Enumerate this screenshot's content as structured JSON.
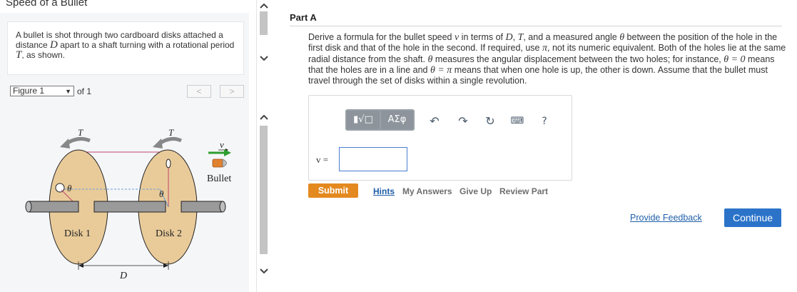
{
  "problem": {
    "title": "Speed of a Bullet",
    "intro_part1": "A bullet is shot through two cardboard disks attached a distance ",
    "intro_var1": "D",
    "intro_part2": " apart to a shaft turning with a rotational period ",
    "intro_var2": "T",
    "intro_part3": ", as shown."
  },
  "figure": {
    "selected": "Figure 1",
    "of_label": "of 1",
    "prev_label": "<",
    "next_label": ">",
    "labels": {
      "period_left": "T",
      "period_right": "T",
      "velocity": "v",
      "bullet": "Bullet",
      "theta_left": "θ",
      "theta_right": "θ",
      "disk1": "Disk 1",
      "disk2": "Disk 2",
      "distance": "D"
    },
    "colors": {
      "disk": "#e9cb9a",
      "shaft": "#9a9a9a",
      "bullet": "#e0812f",
      "velocity_arrow": "#2e9e2e",
      "line": "#c0446a"
    }
  },
  "part": {
    "title": "Part A",
    "q1": "Derive a formula for the bullet speed ",
    "v": "v",
    "q2": " in terms of ",
    "D": "D",
    "comma1": ", ",
    "T": "T",
    "q3": ", and a measured angle ",
    "theta": "θ",
    "q4": " between the position of the hole in the first disk and that of the hole in the second. If required, use ",
    "pi": "π",
    "q5": ", not its numeric equivalent. Both of the holes lie at the same radial distance from the shaft. ",
    "theta2": "θ",
    "q6": " measures the angular displacement between the two holes; for instance, ",
    "eq1": "θ = 0",
    "q7": " means that the holes are in a line and ",
    "eq2": "θ = π",
    "q8": " means that when one hole is up, the other is down. Assume that the bullet must travel through the set of disks within a single revolution."
  },
  "toolbar": {
    "template_label": "▮√□",
    "greek_label": "ΑΣφ",
    "undo_icon": "undo-icon",
    "redo_icon": "redo-icon",
    "reset_icon": "reset-icon",
    "keyboard_icon": "keyboard-icon",
    "help_label": "?"
  },
  "answer": {
    "label": "v =",
    "value": ""
  },
  "actions": {
    "submit": "Submit",
    "hints": "Hints",
    "my_answers": "My Answers",
    "give_up": "Give Up",
    "review_part": "Review Part",
    "feedback": "Provide Feedback",
    "continue": "Continue"
  }
}
